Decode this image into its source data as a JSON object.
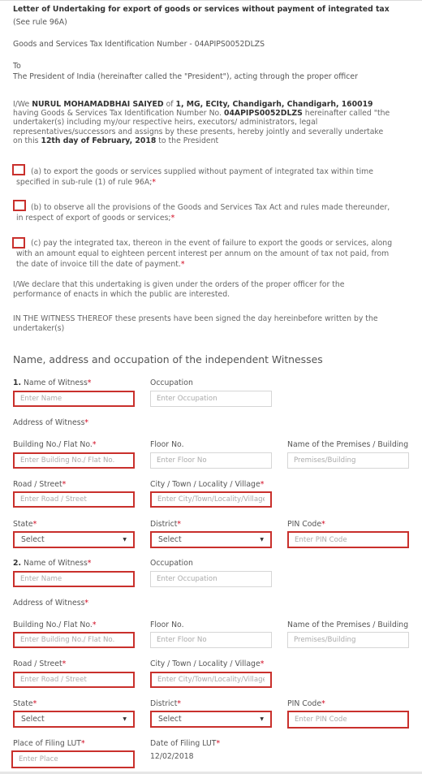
{
  "header": {
    "title": "Letter of Undertaking for export of goods or services without payment of integrated tax",
    "rule_ref": "(See rule 96A)",
    "gstin_line": "Goods and Services Tax Identification Number - 04APIPS0052DLZS",
    "to": "To",
    "addressee": "The President of India (hereinafter called the \"President\"), acting through the proper officer"
  },
  "undertaking": {
    "prefix": "I/We ",
    "name": "NURUL MOHAMADBHAI SAIYED",
    "of": " of ",
    "address": "1, MG, ECIty, Chandigarh, Chandigarh, 160019",
    "having": " having Goods & Services Tax Identification Number No. ",
    "gstin": "04APIPS0052DLZS",
    "body": " hereinafter called \"the undertaker(s) including my/our respective heirs, executors/ administrators, legal representatives/successors and assigns by these presents, hereby jointly and severally undertake on this ",
    "date": "12th day of February, 2018",
    "suffix": " to the President"
  },
  "clauses": [
    {
      "text": "(a) to export the goods or services supplied without payment of integrated tax within time specified in sub-rule (1) of rule 96A;",
      "checked": false
    },
    {
      "text": "(b) to observe all the provisions of the Goods and Services Tax Act and rules made thereunder, in respect of export of goods or services;",
      "checked": false
    },
    {
      "text": "(c) pay the integrated tax, thereon in the event of failure to export the goods or services, along with an amount equal to eighteen percent interest per annum on the amount of tax not paid, from the date of invoice till the date of payment.",
      "checked": false
    }
  ],
  "required_mark": "*",
  "declaration": "I/We declare that this undertaking is given under the orders of the proper officer for the performance of enacts in which the public are interested.",
  "witness_statement": "IN THE WITNESS THEREOF these presents have been signed the day hereinbefore written by the undertaker(s)",
  "witness_section_title": "Name, address and occupation of the independent Witnesses",
  "witnesses": [
    {
      "number": "1.",
      "name_label": " Name of Witness",
      "name_placeholder": "Enter Name",
      "occupation_label": "Occupation",
      "occupation_placeholder": "Enter Occupation",
      "address_label": "Address of Witness",
      "building_label": "Building No./ Flat No.",
      "building_placeholder": "Enter Building No./ Flat No.",
      "floor_label": "Floor No.",
      "floor_placeholder": "Enter Floor No",
      "premises_label": "Name of the Premises / Building",
      "premises_placeholder": "Premises/Building",
      "road_label": "Road / Street",
      "road_placeholder": "Enter Road / Street",
      "city_label": "City / Town / Locality / Village",
      "city_placeholder": "Enter City/Town/Locality/Village",
      "state_label": "State",
      "state_value": "Select",
      "district_label": "District",
      "district_value": "Select",
      "pin_label": "PIN Code",
      "pin_placeholder": "Enter PIN Code"
    },
    {
      "number": "2.",
      "name_label": " Name of Witness",
      "name_placeholder": "Enter Name",
      "occupation_label": "Occupation",
      "occupation_placeholder": "Enter Occupation",
      "address_label": "Address of Witness",
      "building_label": "Building No./ Flat No.",
      "building_placeholder": "Enter Building No./ Flat No.",
      "floor_label": "Floor No.",
      "floor_placeholder": "Enter Floor No",
      "premises_label": "Name of the Premises / Building",
      "premises_placeholder": "Premises/Building",
      "road_label": "Road / Street",
      "road_placeholder": "Enter Road / Street",
      "city_label": "City / Town / Locality / Village",
      "city_placeholder": "Enter City/Town/Locality/Village",
      "state_label": "State",
      "state_value": "Select",
      "district_label": "District",
      "district_value": "Select",
      "pin_label": "PIN Code",
      "pin_placeholder": "Enter PIN Code"
    }
  ],
  "filing": {
    "place_label": "Place of Filing LUT",
    "place_placeholder": "Enter Place",
    "date_label": "Date of Filing LUT",
    "date_value": "12/02/2018"
  },
  "icons": {
    "dropdown": "▼"
  },
  "colors": {
    "error_border": "#c9302c",
    "required": "#d0021b"
  }
}
